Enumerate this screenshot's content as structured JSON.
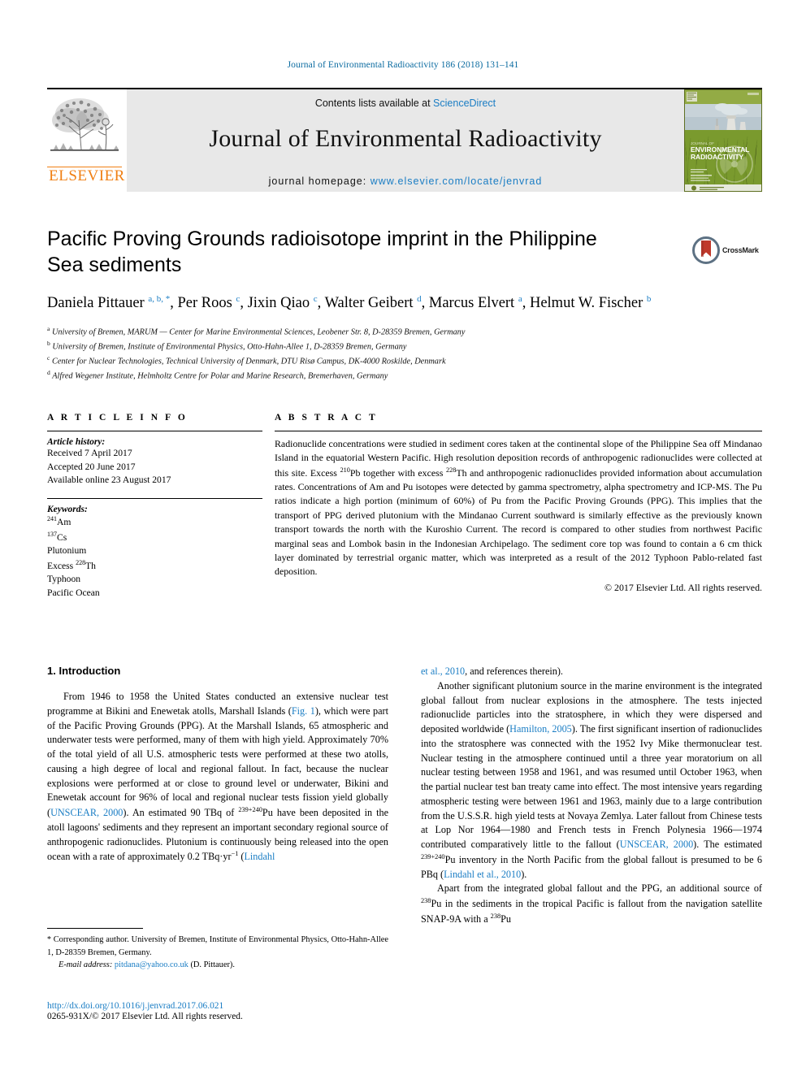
{
  "running_head": "Journal of Environmental Radioactivity 186 (2018) 131–141",
  "masthead": {
    "contents_prefix": "Contents lists available at ",
    "sciencedirect": "ScienceDirect",
    "journal_title": "Journal of Environmental Radioactivity",
    "homepage_label": "journal homepage: ",
    "homepage_url": "www.elsevier.com/locate/jenvrad",
    "publisher_wordmark": "ELSEVIER",
    "cover_title_line1": "JOURNAL OF",
    "cover_title_line2": "ENVIRONMENTAL",
    "cover_title_line3": "RADIOACTIVITY",
    "accent_orange": "#f07f13",
    "accent_blue": "#1a7dc4",
    "cover_green": "#7a9a2e"
  },
  "crossmark": {
    "label": "CrossMark",
    "ribbon_color": "#c0392b",
    "ring_color": "#5d7183"
  },
  "article": {
    "title": "Pacific Proving Grounds radioisotope imprint in the Philippine Sea sediments",
    "authors_html": "Daniela Pittauer <sup>a, b, *</sup>, Per Roos <sup>c</sup>, Jixin Qiao <sup>c</sup>, Walter Geibert <sup>d</sup>, Marcus Elvert <sup>a</sup>, Helmut W. Fischer <sup>b</sup>",
    "affiliations": [
      {
        "marker": "a",
        "text": "University of Bremen, MARUM — Center for Marine Environmental Sciences, Leobener Str. 8, D-28359 Bremen, Germany"
      },
      {
        "marker": "b",
        "text": "University of Bremen, Institute of Environmental Physics, Otto-Hahn-Allee 1, D-28359 Bremen, Germany"
      },
      {
        "marker": "c",
        "text": "Center for Nuclear Technologies, Technical University of Denmark, DTU Risø Campus, DK-4000 Roskilde, Denmark"
      },
      {
        "marker": "d",
        "text": "Alfred Wegener Institute, Helmholtz Centre for Polar and Marine Research, Bremerhaven, Germany"
      }
    ]
  },
  "article_info": {
    "heading": "A R T I C L E  I N F O",
    "history_label": "Article history:",
    "history": [
      "Received 7 April 2017",
      "Accepted 20 June 2017",
      "Available online 23 August 2017"
    ],
    "keywords_label": "Keywords:",
    "keywords_html": [
      "<sup>241</sup>Am",
      "<sup>137</sup>Cs",
      "Plutonium",
      "Excess <sup>228</sup>Th",
      "Typhoon",
      "Pacific Ocean"
    ]
  },
  "abstract": {
    "heading": "A B S T R A C T",
    "body_html": "Radionuclide concentrations were studied in sediment cores taken at the continental slope of the Philippine Sea off Mindanao Island in the equatorial Western Pacific. High resolution deposition records of anthropogenic radionuclides were collected at this site. Excess <sup>210</sup>Pb together with excess <sup>228</sup>Th and anthropogenic radionuclides provided information about accumulation rates. Concentrations of Am and Pu isotopes were detected by gamma spectrometry, alpha spectrometry and ICP-MS. The Pu ratios indicate a high portion (minimum of 60%) of Pu from the Pacific Proving Grounds (PPG). This implies that the transport of PPG derived plutonium with the Mindanao Current southward is similarly effective as the previously known transport towards the north with the Kuroshio Current. The record is compared to other studies from northwest Pacific marginal seas and Lombok basin in the Indonesian Archipelago. The sediment core top was found to contain a 6 cm thick layer dominated by terrestrial organic matter, which was interpreted as a result of the 2012 Typhoon Pablo-related fast deposition.",
    "copyright": "© 2017 Elsevier Ltd. All rights reserved."
  },
  "body": {
    "section_heading": "1. Introduction",
    "left_p1_html": "From 1946 to 1958 the United States conducted an extensive nuclear test programme at Bikini and Enewetak atolls, Marshall Islands (<a class=\"ref\" data-name=\"figure-link-fig1\" data-interactable=\"true\" href=\"#\">Fig. 1</a>), which were part of the Pacific Proving Grounds (PPG). At the Marshall Islands, 65 atmospheric and underwater tests were performed, many of them with high yield. Approximately 70% of the total yield of all U.S. atmospheric tests were performed at these two atolls, causing a high degree of local and regional fallout. In fact, because the nuclear explosions were performed at or close to ground level or underwater, Bikini and Enewetak account for 96% of local and regional nuclear tests fission yield globally (<a class=\"ref\" data-name=\"citation-link-unscear-2000\" data-interactable=\"true\" href=\"#\">UNSCEAR, 2000</a>). An estimated 90 TBq of <sup>239+240</sup>Pu have been deposited in the atoll lagoons' sediments and they represent an important secondary regional source of anthropogenic radionuclides. Plutonium is continuously being released into the open ocean with a rate of approximately 0.2 TBq·yr<sup>−1</sup> (<a class=\"ref\" data-name=\"citation-link-lindahl-2010\" data-interactable=\"true\" href=\"#\">Lindahl</a>",
    "right_p0_html": "<a class=\"ref\" data-name=\"citation-link-lindahl-2010-cont\" data-interactable=\"true\" href=\"#\">et al., 2010</a>, and references therein).",
    "right_p1_html": "Another significant plutonium source in the marine environment is the integrated global fallout from nuclear explosions in the atmosphere. The tests injected radionuclide particles into the stratosphere, in which they were dispersed and deposited worldwide (<a class=\"ref\" data-name=\"citation-link-hamilton-2005\" data-interactable=\"true\" href=\"#\">Hamilton, 2005</a>). The first significant insertion of radionuclides into the stratosphere was connected with the 1952 Ivy Mike thermonuclear test. Nuclear testing in the atmosphere continued until a three year moratorium on all nuclear testing between 1958 and 1961, and was resumed until October 1963, when the partial nuclear test ban treaty came into effect. The most intensive years regarding atmospheric testing were between 1961 and 1963, mainly due to a large contribution from the U.S.S.R. high yield tests at Novaya Zemlya. Later fallout from Chinese tests at Lop Nor 1964—1980 and French tests in French Polynesia 1966—1974 contributed comparatively little to the fallout (<a class=\"ref\" data-name=\"citation-link-unscear-2000-b\" data-interactable=\"true\" href=\"#\">UNSCEAR, 2000</a>). The estimated <sup>239+240</sup>Pu inventory in the North Pacific from the global fallout is presumed to be 6 PBq (<a class=\"ref\" data-name=\"citation-link-lindahl-et-al-2010\" data-interactable=\"true\" href=\"#\">Lindahl et al., 2010</a>).",
    "right_p2_html": "Apart from the integrated global fallout and the PPG, an additional source of <sup>238</sup>Pu in the sediments in the tropical Pacific is fallout from the navigation satellite SNAP-9A with a <sup>238</sup>Pu"
  },
  "footnote": {
    "corresponding_html": "<span class=\"star\">*</span> Corresponding author. University of Bremen, Institute of Environmental Physics, Otto-Hahn-Allee 1, D-28359 Bremen, Germany.",
    "email_label": "E-mail address: ",
    "email": "pitdana@yahoo.co.uk",
    "email_suffix": " (D. Pittauer)."
  },
  "footer": {
    "doi": "http://dx.doi.org/10.1016/j.jenvrad.2017.06.021",
    "issn_line": "0265-931X/© 2017 Elsevier Ltd. All rights reserved."
  }
}
